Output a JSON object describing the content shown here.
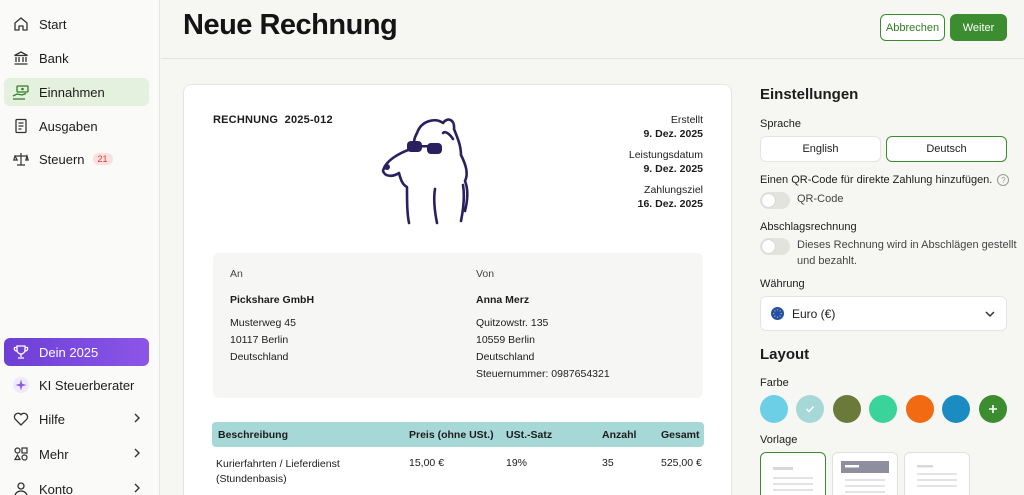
{
  "sidebar": {
    "items": [
      {
        "label": "Start",
        "icon": "home-icon"
      },
      {
        "label": "Bank",
        "icon": "bank-icon"
      },
      {
        "label": "Einnahmen",
        "icon": "money-hand-icon",
        "active": true
      },
      {
        "label": "Ausgaben",
        "icon": "receipt-icon"
      },
      {
        "label": "Steuern",
        "icon": "scale-icon",
        "badge": "21"
      }
    ],
    "bottom": [
      {
        "label": "Dein 2025",
        "icon": "trophy-icon"
      },
      {
        "label": "KI Steuerberater",
        "icon": "sparkle-icon"
      },
      {
        "label": "Hilfe",
        "icon": "heart-icon"
      },
      {
        "label": "Mehr",
        "icon": "shapes-icon"
      },
      {
        "label": "Konto",
        "icon": "user-icon"
      }
    ]
  },
  "header": {
    "title": "Neue Rechnung",
    "cancel_label": "Abbrechen",
    "next_label": "Weiter"
  },
  "invoice": {
    "title": "RECHNUNG  2025-012",
    "created_label": "Erstellt",
    "created_value": "9. Dez. 2025",
    "service_label": "Leistungsdatum",
    "service_value": "9. Dez. 2025",
    "due_label": "Zahlungsziel",
    "due_value": "16. Dez. 2025",
    "to_label": "An",
    "to_name": "Pickshare GmbH",
    "to_street": "Musterweg 45",
    "to_city": "10117 Berlin",
    "to_country": "Deutschland",
    "from_label": "Von",
    "from_name": "Anna Merz",
    "from_street": "Quitzowstr. 135",
    "from_city": "10559 Berlin",
    "from_country": "Deutschland",
    "from_tax": "Steuernummer: 0987654321",
    "columns": [
      "Beschreibung",
      "Preis (ohne USt.)",
      "USt.-Satz",
      "Anzahl",
      "Gesamt"
    ],
    "rows": [
      {
        "desc_1": "Kurierfahrten / Lieferdienst",
        "desc_2": "(Stundenbasis)",
        "price": "15,00 €",
        "vat": "19%",
        "qty": "35",
        "total": "525,00 €"
      }
    ]
  },
  "settings": {
    "title": "Einstellungen",
    "language_label": "Sprache",
    "lang_en": "English",
    "lang_de": "Deutsch",
    "qr_text": "Einen QR-Code für direkte Zahlung hinzufügen.",
    "qr_toggle_label": "QR-Code",
    "partial_label": "Abschlagsrechnung",
    "partial_text_1": "Dieses Rechnung wird in Abschlägen gestellt",
    "partial_text_2": "und bezahlt.",
    "currency_label": "Währung",
    "currency_value": "Euro (€)",
    "layout_title": "Layout",
    "color_label": "Farbe",
    "colors": [
      "#6dcfe6",
      "#a6d8d7",
      "#6b7a3a",
      "#3ad49a",
      "#f26a12",
      "#1a8cc2",
      "#3c8c30"
    ],
    "template_label": "Vorlage"
  }
}
